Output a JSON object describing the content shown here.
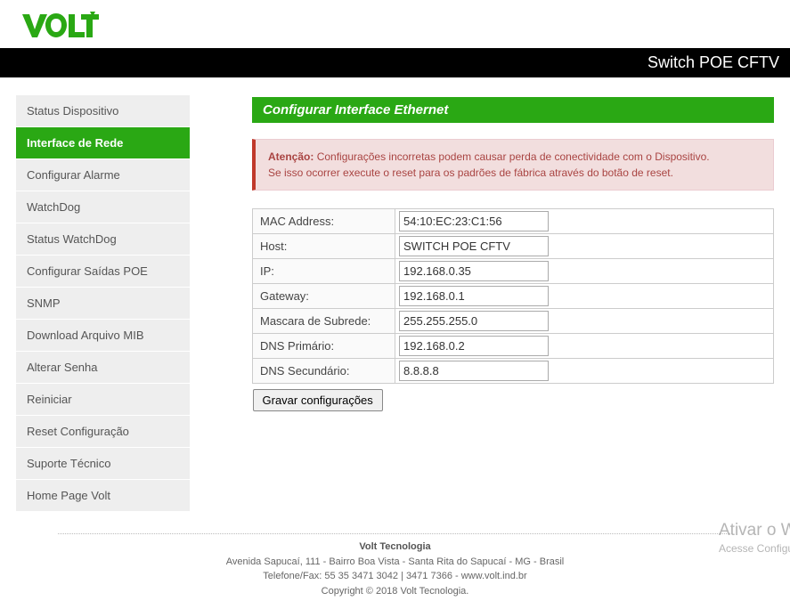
{
  "brand_name": "VOLT",
  "blackbar_title": "Switch POE CFTV",
  "sidebar": {
    "items": [
      {
        "label": "Status Dispositivo"
      },
      {
        "label": "Interface de Rede"
      },
      {
        "label": "Configurar Alarme"
      },
      {
        "label": "WatchDog"
      },
      {
        "label": "Status WatchDog"
      },
      {
        "label": "Configurar Saídas POE"
      },
      {
        "label": "SNMP"
      },
      {
        "label": "Download Arquivo MIB"
      },
      {
        "label": "Alterar Senha"
      },
      {
        "label": "Reiniciar"
      },
      {
        "label": "Reset Configuração"
      },
      {
        "label": "Suporte Técnico"
      },
      {
        "label": "Home Page Volt"
      }
    ],
    "active_index": 1
  },
  "page_title": "Configurar Interface Ethernet",
  "alert": {
    "title": "Atenção:",
    "line1": "Configurações incorretas podem causar perda de conectividade com o Dispositivo.",
    "line2": "Se isso ocorrer execute o reset para os padrões de fábrica através do botão de reset."
  },
  "form": {
    "mac": {
      "label": "MAC Address:",
      "value": "54:10:EC:23:C1:56"
    },
    "host": {
      "label": "Host:",
      "value": "SWITCH POE CFTV"
    },
    "ip": {
      "label": "IP:",
      "value": "192.168.0.35"
    },
    "gateway": {
      "label": "Gateway:",
      "value": "192.168.0.1"
    },
    "mask": {
      "label": "Mascara de Subrede:",
      "value": "255.255.255.0"
    },
    "dns1": {
      "label": "DNS Primário:",
      "value": "192.168.0.2"
    },
    "dns2": {
      "label": "DNS Secundário:",
      "value": "8.8.8.8"
    },
    "save_label": "Gravar configurações"
  },
  "footer": {
    "company": "Volt Tecnologia",
    "address": "Avenida Sapucaí, 111 - Bairro Boa Vista - Santa Rita do Sapucaí - MG - Brasil",
    "phone": "Telefone/Fax: 55 35 3471 3042 | 3471 7366 - www.volt.ind.br",
    "copyright": "Copyright © 2018 Volt Tecnologia."
  },
  "watermark": {
    "line1": "Ativar o Windows",
    "line2": "Acesse Configurações"
  }
}
